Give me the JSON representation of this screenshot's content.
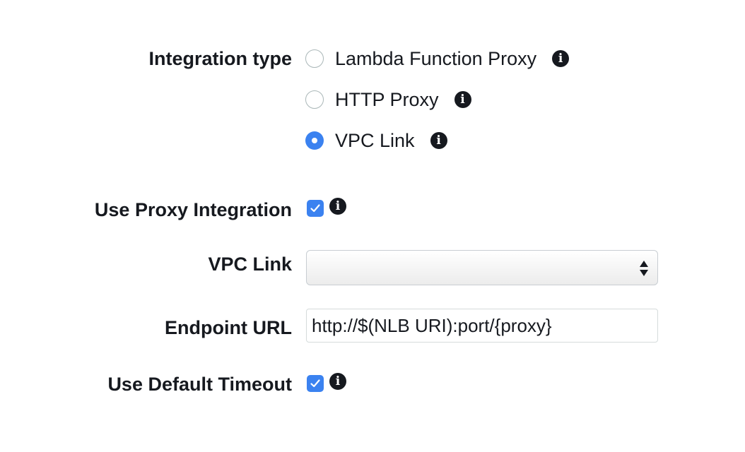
{
  "integration_type": {
    "label": "Integration type",
    "options": [
      {
        "label": "Lambda Function Proxy",
        "selected": false
      },
      {
        "label": "HTTP Proxy",
        "selected": false
      },
      {
        "label": "VPC Link",
        "selected": true
      }
    ]
  },
  "use_proxy_integration": {
    "label": "Use Proxy Integration",
    "checked": true
  },
  "vpc_link": {
    "label": "VPC Link",
    "selected_value": ""
  },
  "endpoint_url": {
    "label": "Endpoint URL",
    "value": "http://$(NLB URI):port/{proxy}"
  },
  "use_default_timeout": {
    "label": "Use Default Timeout",
    "checked": true
  },
  "icons": {
    "info": "info-icon",
    "check": "checkmark-icon",
    "select_arrows": "sort-arrows-icon"
  },
  "colors": {
    "accent": "#3b82f0",
    "text": "#16191f",
    "border": "#d5dbdb"
  }
}
